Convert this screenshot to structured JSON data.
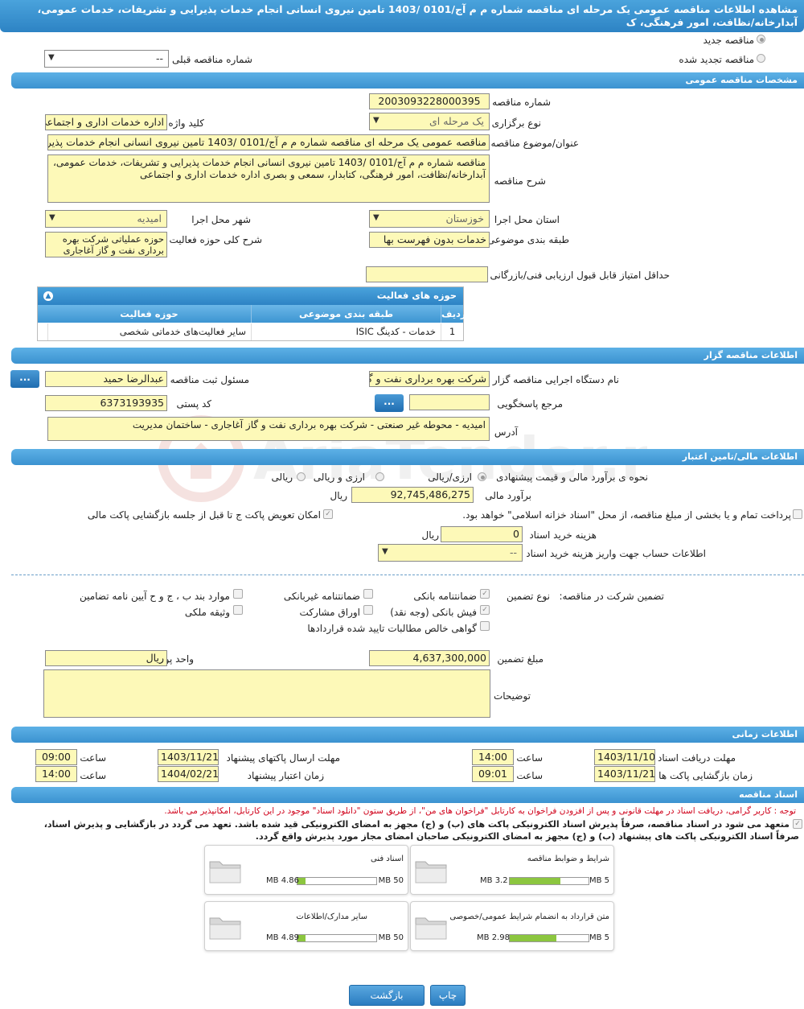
{
  "title": "مشاهده اطلاعات مناقصه عمومی یک مرحله ای مناقصه شماره م م آج/0101 /1403 تامین نیروی انسانی انجام خدمات پذیرایی و تشریفات، خدمات عمومی، آبدارخانه/نظافت، امور فرهنگی، ک",
  "top": {
    "new_label": "مناقصه جدید",
    "renewed_label": "مناقصه تجدید شده",
    "prev_label": "شماره مناقصه قبلی",
    "prev_value": "--"
  },
  "general": {
    "header": "مشخصات مناقصه عمومی",
    "number_label": "شماره مناقصه",
    "number_value": "2003093228000395",
    "type_label": "نوع برگزاری",
    "type_value": "یک مرحله ای",
    "keyword_label": "کلید واژه",
    "keyword_value": "اداره خدمات اداری و اجتماعی",
    "subject_label": "عنوان/موضوع مناقصه",
    "subject_value": "مناقصه عمومی یک مرحله ای مناقصه شماره م م آج/0101 /1403 تامین نیروی انسانی انجام خدمات پذیرایی",
    "desc_label": "شرح مناقصه",
    "desc_value": "مناقصه شماره م م آج/0101 /1403 تامین نیروی انسانی انجام خدمات پذیرایی و تشریفات، خدمات عمومی، آبدارخانه/نظافت، امور فرهنگی، کتابدار، سمعی و بصری اداره خدمات اداری و اجتماعی",
    "province_label": "استان محل اجرا",
    "province_value": "خوزستان",
    "city_label": "شهر محل اجرا",
    "city_value": "امیدیه",
    "category_label": "طبقه بندی موضوعی",
    "category_value": "خدمات بدون فهرست بها",
    "scope_label": "شرح کلی حوزه فعالیت",
    "scope_value": "حوزه عملیاتی شرکت بهره برداری نفت و گاز آغاجاری",
    "min_score_label": "حداقل امتیاز قابل قبول ارزیابی فنی/بازرگانی",
    "min_score_value": ""
  },
  "activity_table": {
    "title": "حوزه های فعالیت",
    "headers": [
      "ردیف",
      "طبقه بندی موضوعی",
      "حوزه فعالیت"
    ],
    "rows": [
      [
        "1",
        "خدمات - کدینگ ISIC",
        "سایر فعالیت‌های خدماتی شخصی"
      ]
    ]
  },
  "organizer": {
    "header": "اطلاعات مناقصه گزار",
    "org_label": "نام دستگاه اجرایی مناقصه گزار",
    "org_value": "شرکت بهره برداری نفت و گاز آغاجاری",
    "reg_label": "مسئول ثبت مناقصه",
    "reg_value": "عبدالرضا  حمید",
    "ref_label": "مرجع پاسخگویی",
    "ref_value": "",
    "postal_label": "کد پستی",
    "postal_value": "6373193935",
    "address_label": "آدرس",
    "address_value": "امیدیه - محوطه غیر صنعتی - شرکت بهره برداری نفت و گاز آغاجاری - ساختمان مدیریت",
    "dots": "..."
  },
  "finance": {
    "header": "اطلاعات مالی/تامین اعتبار",
    "method_label": "نحوه ی برآورد مالی و قیمت پیشنهادی",
    "opt1": "ارزی/ریالی",
    "opt2": "ارزی و ریالی",
    "opt3": "ریالی",
    "estimate_label": "برآورد مالی",
    "estimate_value": "92,745,486,275",
    "rial": "ریال",
    "payment_label": "پرداخت تمام و یا بخشی از مبلغ مناقصه، از محل \"اسناد خزانه اسلامی\" خواهد بود.",
    "swap_label": "امکان تعویض پاکت ج تا قبل از جلسه بازگشایی پاکت مالی",
    "fee_label": "هزینه خرید اسناد",
    "fee_value": "0",
    "account_label": "اطلاعات حساب جهت واریز هزینه خرید اسناد",
    "account_value": "--"
  },
  "guarantee": {
    "label": "تضمین شرکت در مناقصه:",
    "type_label": "نوع تضمین",
    "options": [
      "ضمانتنامه بانکی",
      "ضمانتنامه غیربانکی",
      "موارد بند ب ، ج و ح آیین نامه تضامین",
      "فیش بانکی (وجه نقد)",
      "اوراق مشارکت",
      "وثیقه ملکی",
      "گواهی خالص مطالبات تایید شده قراردادها"
    ],
    "amount_label": "مبلغ تضمین",
    "amount_value": "4,637,300,000",
    "currency_label": "واحد پول",
    "currency_value": "ریال",
    "notes_label": "توضیحات",
    "notes_value": ""
  },
  "timing": {
    "header": "اطلاعات زمانی",
    "receive_label": "مهلت دریافت اسناد",
    "receive_date": "1403/11/10",
    "receive_time": "14:00",
    "send_label": "مهلت ارسال پاکتهای پیشنهاد",
    "send_date": "1403/11/21",
    "send_time": "09:00",
    "open_label": "زمان بازگشایی پاکت ها",
    "open_date": "1403/11/21",
    "open_time": "09:01",
    "valid_label": "زمان اعتبار پیشنهاد",
    "valid_date": "1404/02/21",
    "valid_time": "14:00",
    "time_label": "ساعت"
  },
  "docs": {
    "header": "اسناد مناقصه",
    "note": "توجه : کاربر گرامی، دریافت اسناد در مهلت قانونی و پس از افزودن فراخوان به کارتابل \"فراخوان های من\"، از طریق ستون \"دانلود اسناد\" موجود در این کارتابل، امکانپذیر می باشد.",
    "commit1": "متعهد می شود در اسناد مناقصه، صرفاً پذیرش اسناد الکترونیکی پاکت های (ب) و (ج) مجهز به امضای الکترونیکی قید شده باشد. تعهد می گردد در بازگشایی و پذیرش اسناد،",
    "commit2": "صرفاً اسناد الکترونیکی پاکت های پیشنهاد (ب) و (ج) مجهز به امضای الکترونیکی صاحبان امضای مجاز مورد پذیرش واقع گردد.",
    "cards": [
      {
        "title": "شرایط و ضوابط مناقصه",
        "max": "5 MB",
        "size": "3.2 MB",
        "ratio": 0.64
      },
      {
        "title": "اسناد فنی",
        "max": "50 MB",
        "size": "4.86 MB",
        "ratio": 0.097
      },
      {
        "title": "متن قرارداد به انضمام شرایط عمومی/خصوصی",
        "max": "5 MB",
        "size": "2.98 MB",
        "ratio": 0.596
      },
      {
        "title": "سایر مدارک/اطلاعات",
        "max": "50 MB",
        "size": "4.89 MB",
        "ratio": 0.098
      }
    ]
  },
  "buttons": {
    "print": "چاپ",
    "back": "بازگشت"
  },
  "colors": {
    "header_blue": "#3b92d0",
    "field_yellow": "#fdf9b8",
    "progress_green": "#8cc63f",
    "note_red": "#d0021b"
  }
}
